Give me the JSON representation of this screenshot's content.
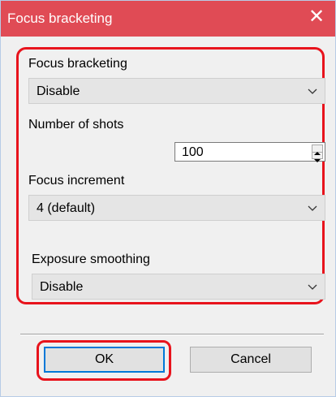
{
  "window": {
    "title": "Focus bracketing",
    "close_icon": "close-icon"
  },
  "fields": {
    "focus_bracketing": {
      "label": "Focus bracketing",
      "value": "Disable"
    },
    "number_of_shots": {
      "label": "Number of shots",
      "value": "100"
    },
    "focus_increment": {
      "label": "Focus increment",
      "value": "4 (default)"
    },
    "exposure_smoothing": {
      "label": "Exposure smoothing",
      "value": "Disable"
    }
  },
  "buttons": {
    "ok": "OK",
    "cancel": "Cancel"
  },
  "colors": {
    "titlebar": "#e04b55",
    "highlight": "#e8131c",
    "focus": "#0078d7"
  }
}
